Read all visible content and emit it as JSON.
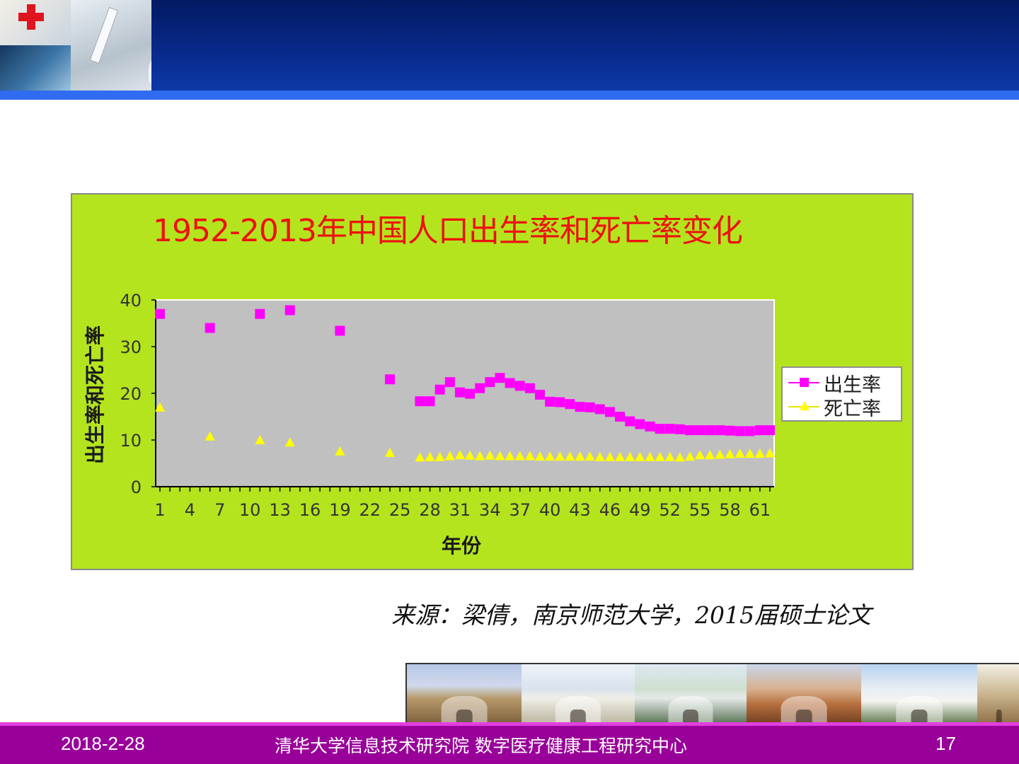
{
  "footer": {
    "date": "2018-2-28",
    "organization": "清华大学信息技术研究院 数字医疗健康工程研究中心",
    "page_number": "17"
  },
  "source_note": "来源：梁倩，南京师范大学，2015届硕士论文",
  "colors": {
    "header_navy": "#031a63",
    "header_strip": "#2f6cf0",
    "chart_background": "#b4e41e",
    "plot_background": "#c0c0c0",
    "title": "#ee1010",
    "birth_rate_series": "#ff00ff",
    "death_rate_series": "#ffff00",
    "footer_purple": "#990099"
  },
  "chart_data": {
    "type": "scatter",
    "title": "1952-2013年中国人口出生率和死亡率变化",
    "xlabel": "年份",
    "ylabel": "出生率和死亡率",
    "xlim": [
      1,
      62
    ],
    "ylim": [
      0,
      40
    ],
    "x_ticks": [
      1,
      4,
      7,
      10,
      13,
      16,
      19,
      22,
      25,
      28,
      31,
      34,
      37,
      40,
      43,
      46,
      49,
      52,
      55,
      58,
      61
    ],
    "y_ticks": [
      0,
      10,
      20,
      30,
      40
    ],
    "grid": false,
    "legend_position": "right",
    "series": [
      {
        "name": "出生率",
        "marker": "square",
        "color": "#ff00ff",
        "x": [
          1,
          6,
          11,
          14,
          19,
          24,
          27,
          28,
          29,
          30,
          31,
          32,
          33,
          34,
          35,
          36,
          37,
          38,
          39,
          40,
          41,
          42,
          43,
          44,
          45,
          46,
          47,
          48,
          49,
          50,
          51,
          52,
          53,
          54,
          55,
          56,
          57,
          58,
          59,
          60,
          61,
          62
        ],
        "y": [
          37,
          34,
          37,
          37.8,
          33.4,
          23,
          18.3,
          18.3,
          20.8,
          22.4,
          20.2,
          19.9,
          21.1,
          22.4,
          23.3,
          22.2,
          21.6,
          21.1,
          19.7,
          18.2,
          18.1,
          17.7,
          17.1,
          17,
          16.6,
          16,
          15,
          14,
          13.4,
          12.9,
          12.4,
          12.4,
          12.3,
          12.1,
          12.1,
          12.1,
          12.1,
          12,
          11.9,
          11.9,
          12.1,
          12.1
        ]
      },
      {
        "name": "死亡率",
        "marker": "triangle",
        "color": "#ffff00",
        "x": [
          1,
          6,
          11,
          14,
          19,
          24,
          27,
          28,
          29,
          30,
          31,
          32,
          33,
          34,
          35,
          36,
          37,
          38,
          39,
          40,
          41,
          42,
          43,
          44,
          45,
          46,
          47,
          48,
          49,
          50,
          51,
          52,
          53,
          54,
          55,
          56,
          57,
          58,
          59,
          60,
          61,
          62
        ],
        "y": [
          17,
          10.8,
          10,
          9.5,
          7.6,
          7.3,
          6.3,
          6.4,
          6.4,
          6.6,
          6.8,
          6.7,
          6.6,
          6.7,
          6.6,
          6.6,
          6.6,
          6.6,
          6.5,
          6.5,
          6.5,
          6.5,
          6.5,
          6.5,
          6.4,
          6.4,
          6.4,
          6.4,
          6.4,
          6.4,
          6.4,
          6.4,
          6.3,
          6.5,
          6.8,
          6.8,
          6.9,
          7,
          7.1,
          7.1,
          7.1,
          7.2
        ]
      }
    ]
  }
}
